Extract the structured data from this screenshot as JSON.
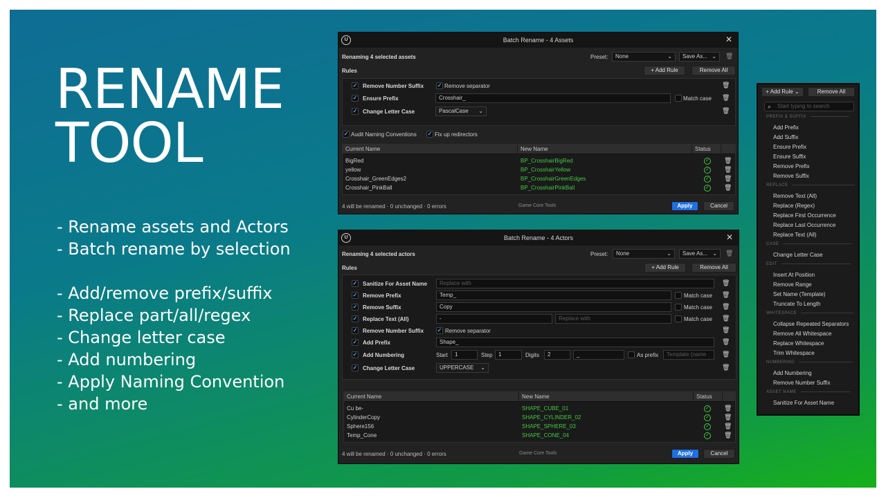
{
  "banner": {
    "title_line1": "RENAME",
    "title_line2": "TOOL",
    "features_a": [
      "- Rename assets and Actors",
      "- Batch rename by selection"
    ],
    "features_b": [
      "- Add/remove prefix/suffix",
      "- Replace part/all/regex",
      "- Change letter case",
      "- Add numbering",
      "- Apply Naming Convention",
      "- and more"
    ]
  },
  "colors": {
    "accent": "#1f6fe0",
    "success": "#43c843",
    "bg_window": "#222222"
  },
  "win1": {
    "title": "Batch Rename - 4 Assets",
    "subtitle": "Renaming 4 selected assets",
    "preset_label": "Preset:",
    "preset_value": "None",
    "save_as": "Save As...",
    "rules_label": "Rules",
    "add_rule": "+ Add Rule",
    "remove_all": "Remove All",
    "rules": [
      {
        "name": "Remove Number Suffix",
        "opt_label": "Remove separator"
      },
      {
        "name": "Ensure Prefix",
        "value": "Crosshair_",
        "match_case": "Match case"
      },
      {
        "name": "Change Letter Case",
        "value": "PascalCase"
      }
    ],
    "audit": "Audit Naming Conventions",
    "fixup": "Fix up redirectors",
    "columns": [
      "Current Name",
      "New Name",
      "Status"
    ],
    "rows": [
      {
        "current": "BigRed",
        "new": "BP_CrosshairBigRed"
      },
      {
        "current": "yellow",
        "new": "BP_CrosshairYellow"
      },
      {
        "current": "Crosshair_GreenEdges2",
        "new": "BP_CrosshairGreenEdges"
      },
      {
        "current": "Crosshair_PinkBall",
        "new": "BP_CrosshairPinkBall"
      }
    ],
    "summary": "4 will be renamed · 0 unchanged · 0 errors",
    "brand": "Game Core Tools",
    "apply": "Apply",
    "cancel": "Cancel"
  },
  "win2": {
    "title": "Batch Rename - 4 Actors",
    "subtitle": "Renaming 4 selected actors",
    "preset_label": "Preset:",
    "preset_value": "None",
    "save_as": "Save As...",
    "rules_label": "Rules",
    "add_rule": "+ Add Rule",
    "remove_all": "Remove All",
    "r1_name": "Sanitize For Asset Name",
    "r1_ph": "Replace with",
    "r2_name": "Remove Prefix",
    "r2_value": "Temp_",
    "r3_name": "Remove Suffix",
    "r3_value": "Copy",
    "r4_name": "Replace Text (All)",
    "r4_value": "-",
    "r4_ph": "Replace with",
    "match_case": "Match case",
    "r5_name": "Remove Number Suffix",
    "r5_opt": "Remove separator",
    "r6_name": "Add Prefix",
    "r6_value": "Shape_",
    "r7_name": "Add Numbering",
    "r7_start_label": "Start",
    "r7_start": "1",
    "r7_step_label": "Step",
    "r7_step": "1",
    "r7_digits_label": "Digits",
    "r7_digits": "2",
    "r7_sep": "_",
    "r7_asprefix": "As prefix",
    "r7_template_ph": "Template (name",
    "r8_name": "Change Letter Case",
    "r8_value": "UPPERCASE",
    "columns": [
      "Current Name",
      "New Name",
      "Status"
    ],
    "rows": [
      {
        "current": "Cu be-",
        "new": "SHAPE_CUBE_01"
      },
      {
        "current": "CylinderCopy",
        "new": "SHAPE_CYLINDER_02"
      },
      {
        "current": "Sphere156",
        "new": "SHAPE_SPHERE_03"
      },
      {
        "current": "Temp_Cone",
        "new": "SHAPE_CONE_04"
      }
    ],
    "summary": "4 will be renamed · 0 unchanged · 0 errors",
    "brand": "Game Core Tools",
    "apply": "Apply",
    "cancel": "Cancel"
  },
  "menu": {
    "add_rule": "+ Add Rule",
    "remove_all": "Remove All",
    "search_placeholder": "Start typing to search",
    "sections": {
      "prefix_suffix": "PREFIX & SUFFIX",
      "replace": "REPLACE",
      "case": "CASE",
      "edit": "EDIT",
      "whitespace": "WHITESPACE",
      "numbering": "NUMBERING",
      "asset_name": "ASSET NAME"
    },
    "items": {
      "add_prefix": "Add Prefix",
      "add_suffix": "Add Suffix",
      "ensure_prefix": "Ensure Prefix",
      "ensure_suffix": "Ensure Suffix",
      "remove_prefix": "Remove Prefix",
      "remove_suffix": "Remove Suffix",
      "remove_text_all": "Remove Text (All)",
      "replace_regex": "Replace (Regex)",
      "replace_first": "Replace First Occurrence",
      "replace_last": "Replace Last Occurrence",
      "replace_text_all": "Replace Text (All)",
      "change_letter_case": "Change Letter Case",
      "insert_at_position": "Insert At Position",
      "remove_range": "Remove Range",
      "set_name_template": "Set Name (Template)",
      "truncate_to_length": "Truncate To Length",
      "collapse_separators": "Collapse Repeated Separators",
      "remove_all_whitespace": "Remove All Whitespace",
      "replace_whitespace": "Replace Whitespace",
      "trim_whitespace": "Trim Whitespace",
      "add_numbering": "Add Numbering",
      "remove_number_suffix": "Remove Number Suffix",
      "sanitize_asset_name": "Sanitize For Asset Name"
    }
  }
}
